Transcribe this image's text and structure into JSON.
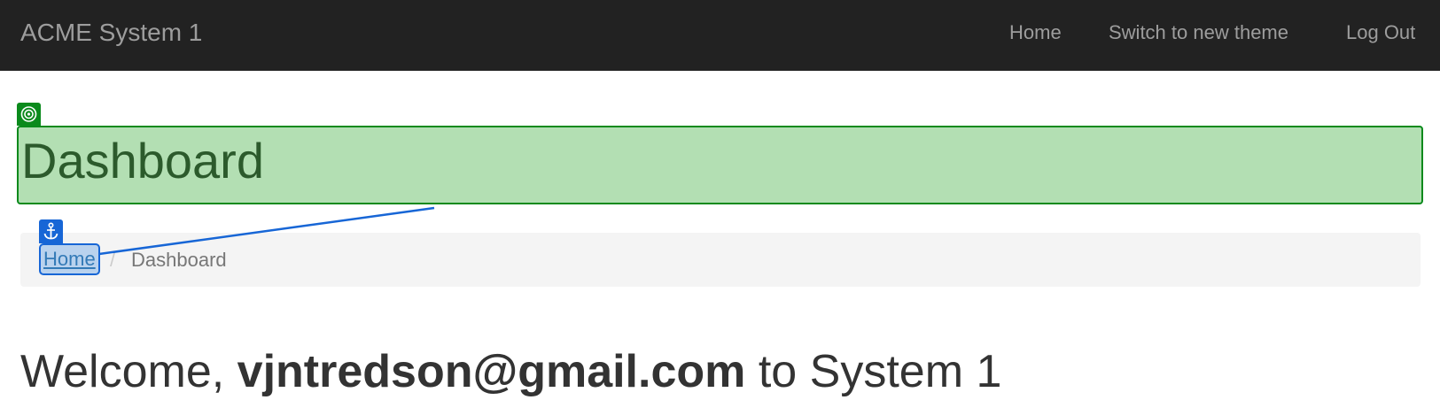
{
  "navbar": {
    "brand": "ACME System 1",
    "links": [
      {
        "label": "Home"
      },
      {
        "label": "Switch to new theme"
      },
      {
        "label": "Log Out"
      }
    ]
  },
  "header": {
    "title": "Dashboard",
    "target_icon": "target-icon"
  },
  "breadcrumb": {
    "home": "Home",
    "separator": "/",
    "current": "Dashboard",
    "anchor_icon": "anchor-icon"
  },
  "welcome": {
    "prefix": "Welcome, ",
    "user": "vjntredson@gmail.com",
    "suffix": " to System 1"
  },
  "colors": {
    "navbar_bg": "#222222",
    "nav_text": "#9d9d9d",
    "header_highlight": "#b3dfb3",
    "header_border": "#0b8a1c",
    "anchor_highlight": "#1766d6",
    "link": "#337ab7"
  }
}
